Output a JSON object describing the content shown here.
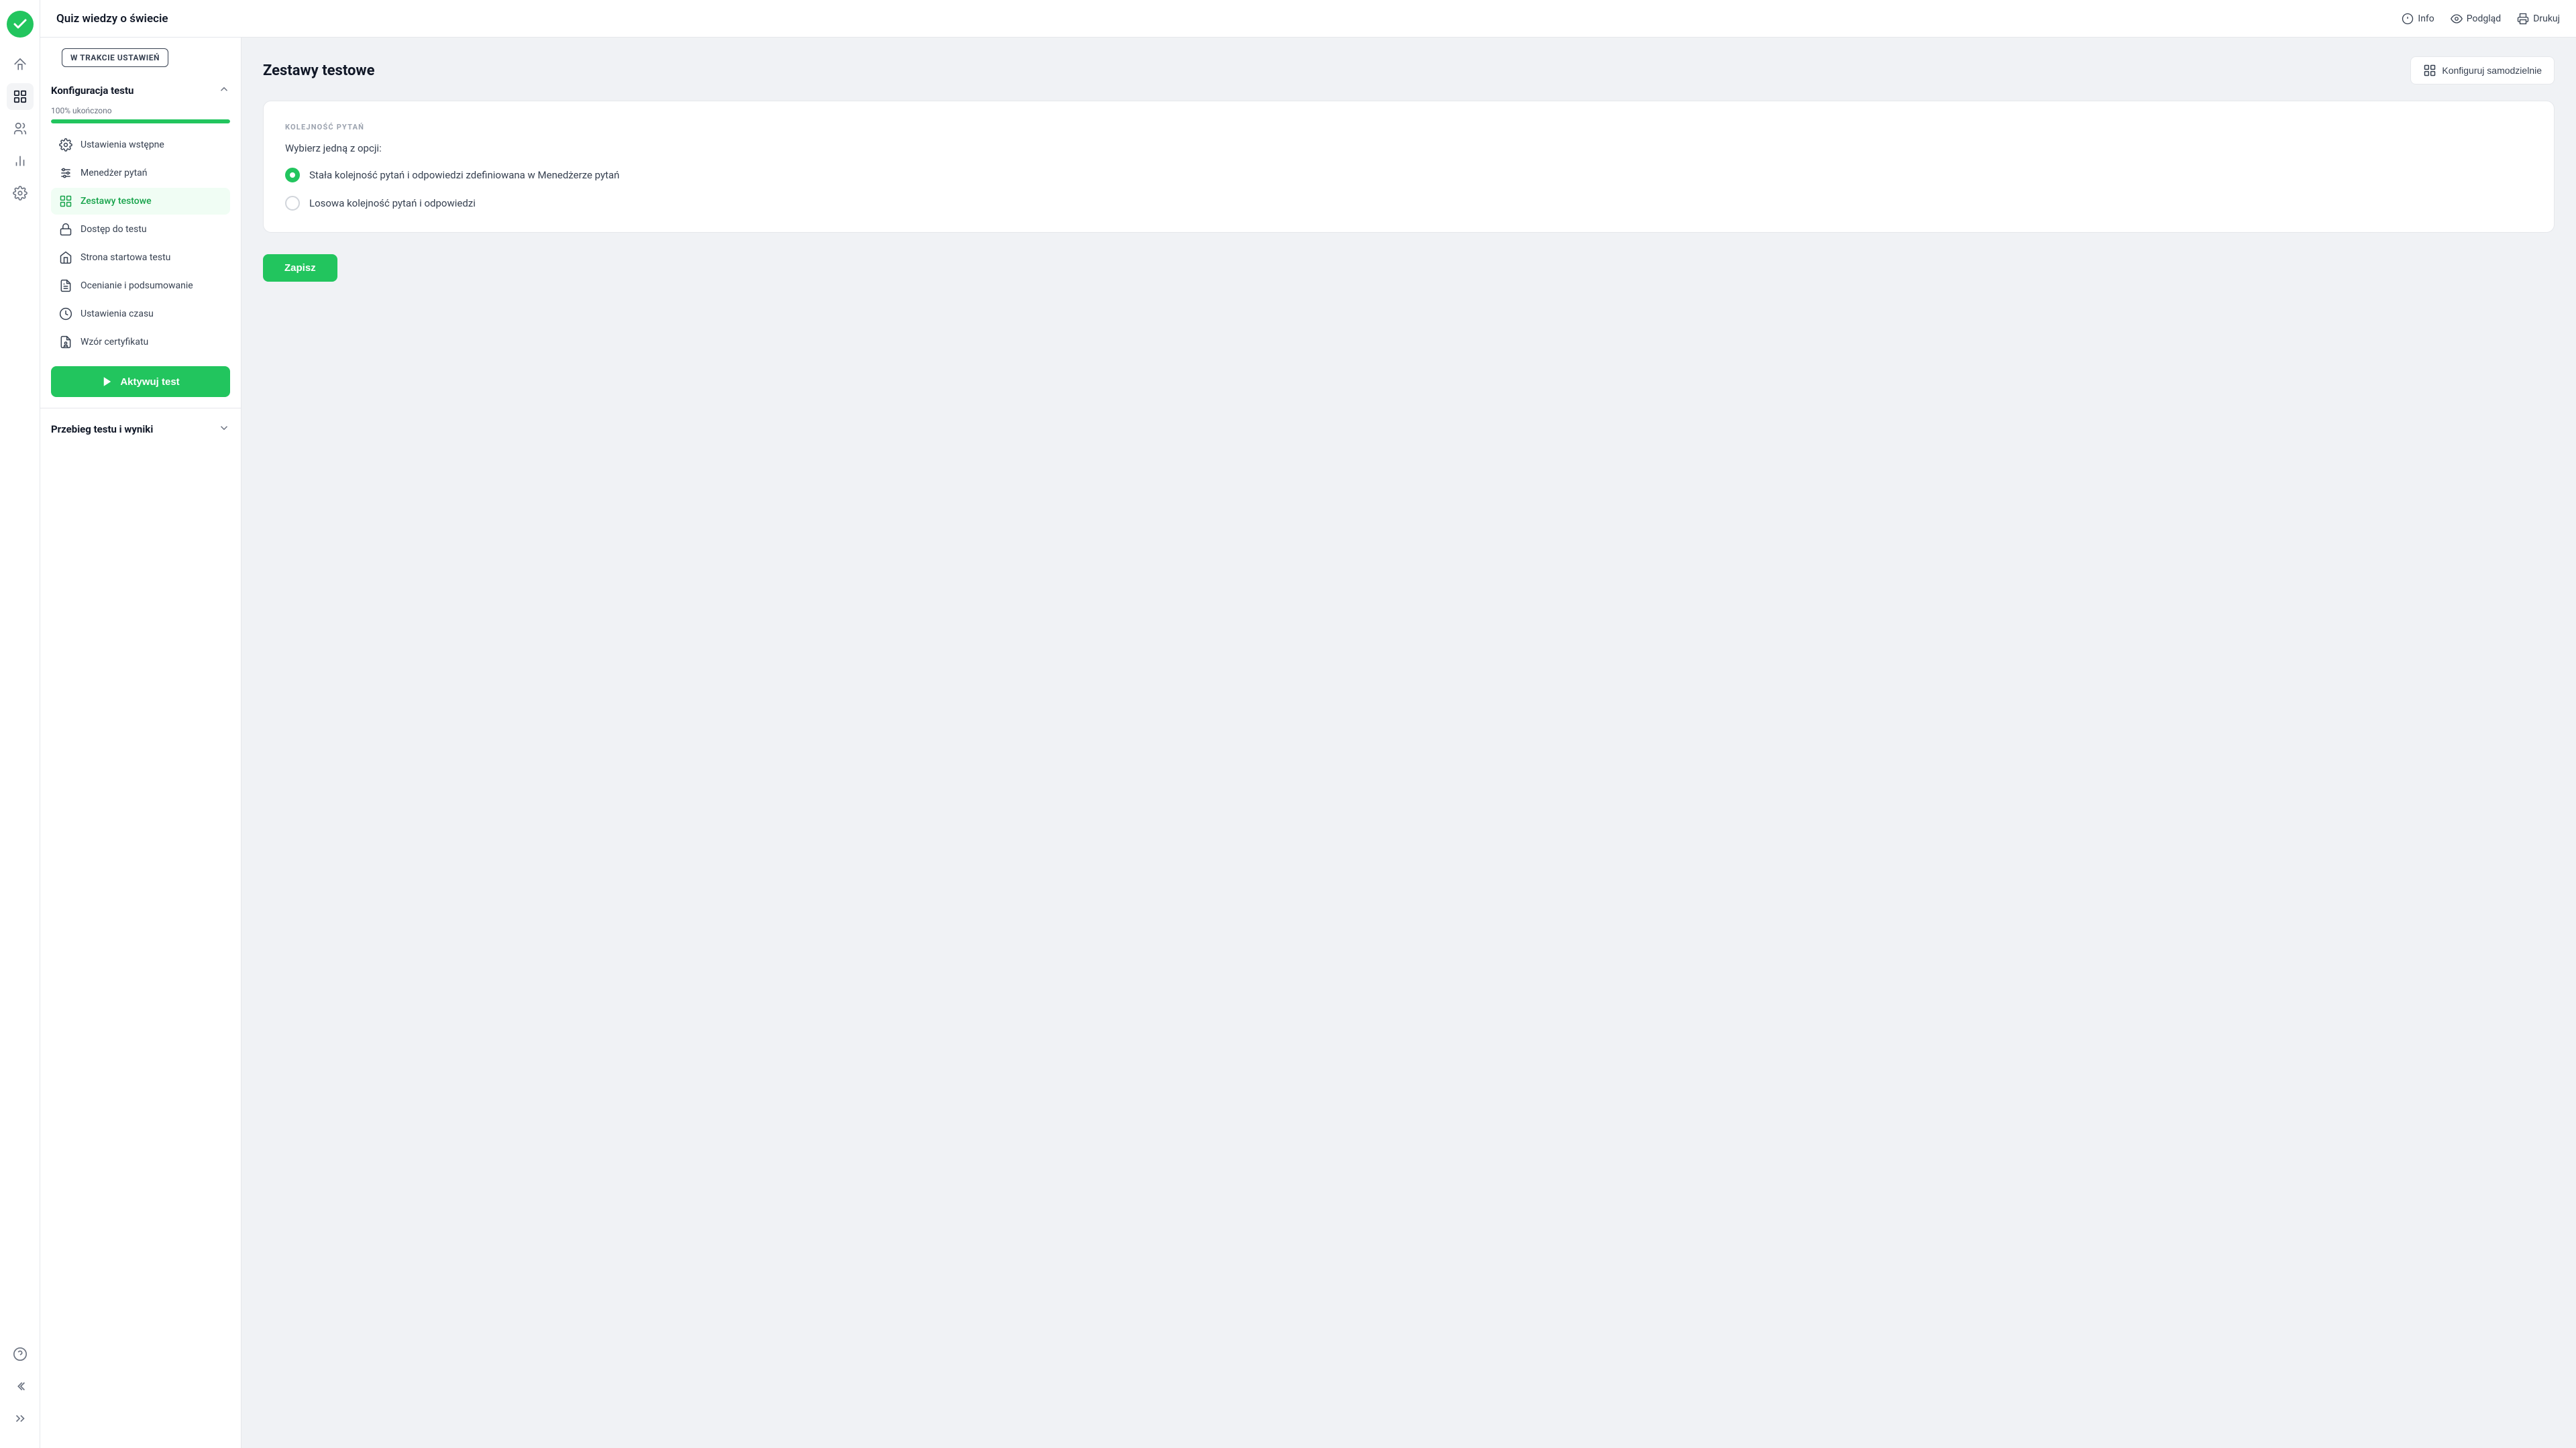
{
  "app": {
    "logo_alt": "App Logo",
    "title": "Quiz wiedzy o świecie"
  },
  "header": {
    "title": "Quiz wiedzy o świecie",
    "actions": [
      {
        "id": "info",
        "label": "Info",
        "icon": "info-icon"
      },
      {
        "id": "preview",
        "label": "Podgląd",
        "icon": "eye-icon"
      },
      {
        "id": "print",
        "label": "Drukuj",
        "icon": "print-icon"
      }
    ]
  },
  "sidebar": {
    "status_badge": "W TRAKCIE USTAWIEŃ",
    "config_section_title": "Konfiguracja testu",
    "progress_label": "100% ukończono",
    "progress_value": 100,
    "nav_items": [
      {
        "id": "ustawienia-wstepne",
        "label": "Ustawienia wstępne",
        "icon": "settings-icon"
      },
      {
        "id": "menedzer-pytan",
        "label": "Menedżer pytań",
        "icon": "sliders-icon"
      },
      {
        "id": "zestawy-testowe",
        "label": "Zestawy testowe",
        "icon": "grid-icon",
        "active": true
      },
      {
        "id": "dostep-do-testu",
        "label": "Dostęp do testu",
        "icon": "lock-icon"
      },
      {
        "id": "strona-startowa",
        "label": "Strona startowa testu",
        "icon": "home-icon"
      },
      {
        "id": "ocenianie",
        "label": "Ocenianie i podsumowanie",
        "icon": "doc-icon"
      },
      {
        "id": "ustawienia-czasu",
        "label": "Ustawienia czasu",
        "icon": "clock-icon"
      },
      {
        "id": "wzor-certyfikatu",
        "label": "Wzór certyfikatu",
        "icon": "certificate-icon"
      }
    ],
    "activate_btn_label": "Aktywuj test",
    "results_section_title": "Przebieg testu i wyniki"
  },
  "main": {
    "page_title": "Zestawy testowe",
    "config_btn_label": "Konfiguruj samodzielnie",
    "card": {
      "section_title": "KOLEJNOŚĆ PYTAŃ",
      "subtitle": "Wybierz jedną z opcji:",
      "options": [
        {
          "id": "fixed",
          "label": "Stała kolejność pytań i odpowiedzi zdefiniowana w Menedżerze pytań",
          "selected": true
        },
        {
          "id": "random",
          "label": "Losowa kolejność pytań i odpowiedzi",
          "selected": false
        }
      ],
      "save_btn_label": "Zapisz"
    }
  },
  "rail_icons": [
    {
      "id": "home",
      "icon": "home-rail-icon"
    },
    {
      "id": "grid",
      "icon": "grid-rail-icon",
      "active": true
    },
    {
      "id": "users",
      "icon": "users-rail-icon"
    },
    {
      "id": "chart",
      "icon": "chart-rail-icon"
    },
    {
      "id": "settings",
      "icon": "settings-rail-icon"
    }
  ],
  "rail_bottom_icons": [
    {
      "id": "help",
      "icon": "help-rail-icon"
    },
    {
      "id": "back",
      "icon": "back-rail-icon"
    },
    {
      "id": "expand",
      "icon": "expand-rail-icon"
    }
  ]
}
